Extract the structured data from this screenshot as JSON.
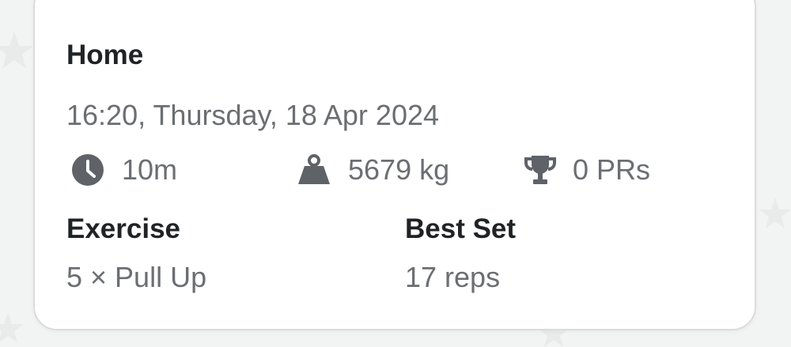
{
  "workout": {
    "title": "Home",
    "datetime": "16:20, Thursday, 18 Apr 2024"
  },
  "stats": {
    "duration": {
      "icon": "clock-icon",
      "value": "10m"
    },
    "volume": {
      "icon": "weight-icon",
      "value": "5679 kg"
    },
    "prs": {
      "icon": "trophy-icon",
      "value": "0 PRs"
    }
  },
  "table": {
    "exercise_header": "Exercise",
    "best_set_header": "Best Set",
    "rows": [
      {
        "exercise": "5 × Pull Up",
        "best_set": "17 reps"
      }
    ]
  },
  "colors": {
    "background": "#f2f3f3",
    "card": "#ffffff",
    "heading_text": "#202326",
    "secondary_text": "#6b6e72",
    "icon": "#5f6368"
  }
}
